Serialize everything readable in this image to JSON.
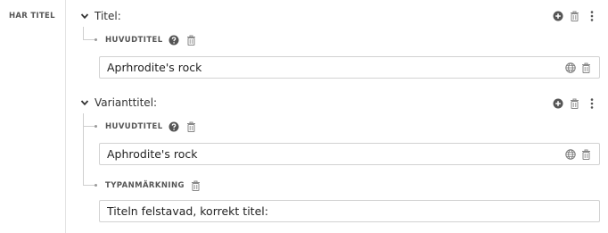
{
  "field": {
    "label": "HAR TITEL"
  },
  "groups": [
    {
      "title": "Titel:",
      "sub_label": "HUVUDTITEL",
      "input_value": "Aprhrodite's rock"
    },
    {
      "title": "Varianttitel:",
      "sub_label": "HUVUDTITEL",
      "input_value": "Aphrodite's rock",
      "extra_label": "TYPANMÄRKNING",
      "extra_value": "Titeln felstavad, korrekt titel:"
    }
  ],
  "icons": {
    "chevron": "chevron-down-icon",
    "add": "add-circle-icon",
    "delete": "trash-icon",
    "more": "more-vertical-icon",
    "help": "help-circle-icon",
    "language": "globe-icon"
  },
  "colors": {
    "icon_dark": "#555555",
    "icon_light": "#8a8a8a",
    "border": "#d2d2d2"
  }
}
